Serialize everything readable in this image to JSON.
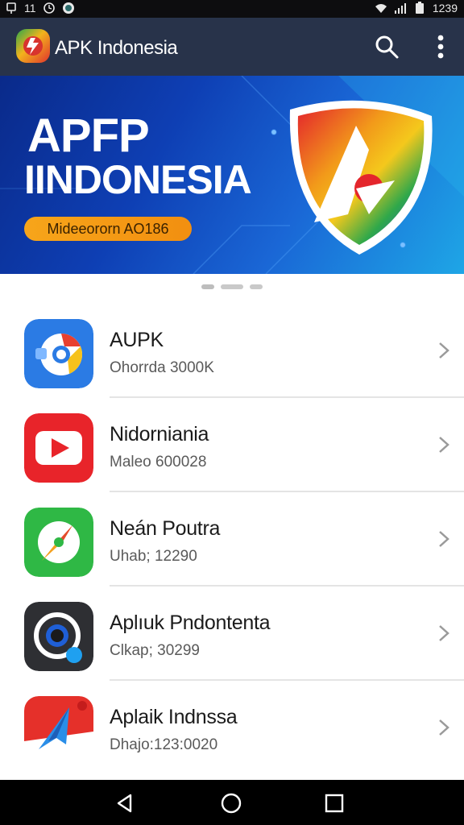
{
  "status_bar": {
    "left_number": "11",
    "time": "1239",
    "icons": [
      "notification-icon",
      "clock-icon",
      "shield-icon",
      "wifi-icon",
      "signal-icon",
      "battery-icon"
    ]
  },
  "app_bar": {
    "title": "APK Indonesia",
    "icons": [
      "app-logo-icon",
      "search-icon",
      "more-vert-icon"
    ],
    "background": "#28334a"
  },
  "banner": {
    "title_line1": "APFP",
    "title_line2": "IINDONESIA",
    "pill_text": "Mideeororn AO186",
    "pill_color": "#f7a51a",
    "pager": {
      "count": 3,
      "active_index": 0
    }
  },
  "apps": [
    {
      "name": "AUPK",
      "meta": "Ohorrda 3000K",
      "icon": "chrome-like-icon"
    },
    {
      "name": "Nidorniania",
      "meta": "Maleo 600028",
      "icon": "play-video-icon"
    },
    {
      "name": "Neán Poutra",
      "meta": "Uhab; 12290",
      "icon": "compass-icon"
    },
    {
      "name": "Aplıuk Pndontenta",
      "meta": "Clkap; 30299",
      "icon": "camera-lens-icon"
    },
    {
      "name": "Aplaik  Indnssa",
      "meta": "Dhajo:123:0020",
      "icon": "paper-plane-icon"
    }
  ],
  "nav_bar": {
    "icons": [
      "back-icon",
      "home-icon",
      "recents-icon"
    ]
  }
}
